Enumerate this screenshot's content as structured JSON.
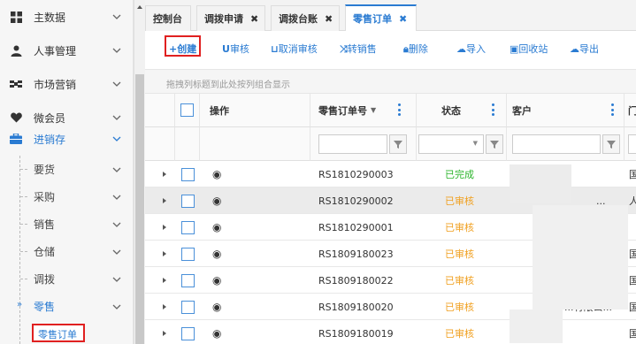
{
  "sidebar": {
    "items": [
      {
        "label": "主数据",
        "icon": "grid-icon"
      },
      {
        "label": "人事管理",
        "icon": "person-icon"
      },
      {
        "label": "市场营销",
        "icon": "share-icon"
      },
      {
        "label": "微会员",
        "icon": "heart-icon"
      },
      {
        "label": "进销存",
        "icon": "briefcase-icon"
      }
    ],
    "sub_items": [
      {
        "label": "要货"
      },
      {
        "label": "采购"
      },
      {
        "label": "销售"
      },
      {
        "label": "仓储"
      },
      {
        "label": "调拨"
      },
      {
        "label": "零售"
      }
    ],
    "active_leaf": "零售订单"
  },
  "tabs": [
    {
      "label": "控制台",
      "closable": false
    },
    {
      "label": "调拨申请",
      "closable": true
    },
    {
      "label": "调拨台账",
      "closable": true
    },
    {
      "label": "零售订单",
      "closable": true
    }
  ],
  "toolbar": {
    "create": "+创建",
    "audit": "审核",
    "unaudit": "取消审核",
    "to_sales": "转销售",
    "delete": "删除",
    "import": "导入",
    "recycle": "回收站",
    "export": "导出"
  },
  "group_hint": "拖拽列标题到此处按列组合显示",
  "grid": {
    "columns": {
      "action": "操作",
      "order_no": "零售订单号",
      "status": "状态",
      "customer": "客户",
      "more": "门"
    },
    "rows": [
      {
        "order_no": "RS1810290003",
        "status": "已完成",
        "customer": "",
        "more": "国"
      },
      {
        "order_no": "RS1810290002",
        "status": "已审核",
        "customer": "...",
        "more": "人"
      },
      {
        "order_no": "RS1810290001",
        "status": "已审核",
        "customer": "",
        "more": ""
      },
      {
        "order_no": "RS1809180023",
        "status": "已审核",
        "customer": "",
        "more": "国"
      },
      {
        "order_no": "RS1809180022",
        "status": "已审核",
        "customer": "",
        "more": "国"
      },
      {
        "order_no": "RS1809180020",
        "status": "已审核",
        "customer": "...有限公...",
        "more": "国"
      },
      {
        "order_no": "RS1809180019",
        "status": "已审核",
        "customer": "",
        "more": "国"
      }
    ]
  },
  "colors": {
    "accent": "#2a7bd2",
    "done": "#2db52d",
    "audited": "#f0a020",
    "highlight": "#e02020"
  }
}
